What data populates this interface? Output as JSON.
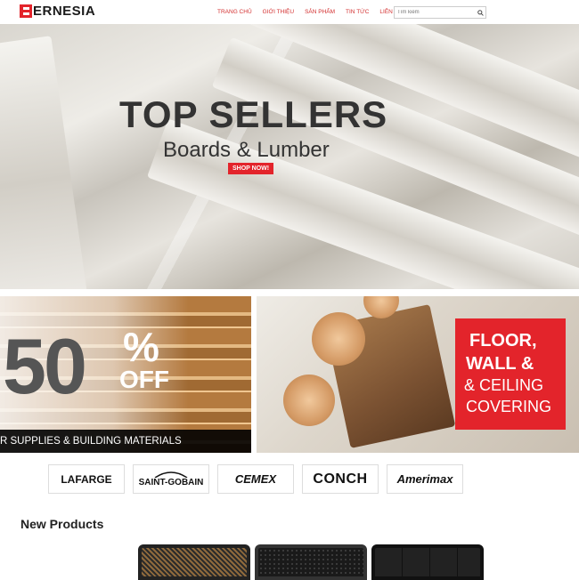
{
  "header": {
    "logo_text": "ERNESIA",
    "nav": [
      "TRANG CHỦ",
      "GIỚI THIỆU",
      "SẢN PHẨM",
      "TIN TỨC",
      "LIÊN HỆ"
    ],
    "search_placeholder": "Tìm kiếm"
  },
  "hero": {
    "title": "TOP SELLERS",
    "subtitle": "Boards & Lumber",
    "button": "SHOP NOW!"
  },
  "promo_left": {
    "number": "50",
    "percent": "%",
    "off": "OFF",
    "strip": "R SUPPLIES & BUILDING MATERIALS"
  },
  "promo_right": {
    "line1": "FLOOR,",
    "line2": "WALL &",
    "line3": "& CEILING",
    "line4": "COVERING"
  },
  "brands": [
    "LAFARGE",
    "SAINT-GOBAIN",
    "CEMEX",
    "CONCH",
    "Amerimax"
  ],
  "new_products": {
    "title": "New Products"
  },
  "colors": {
    "accent": "#e3242b",
    "nav": "#d32f2f"
  }
}
